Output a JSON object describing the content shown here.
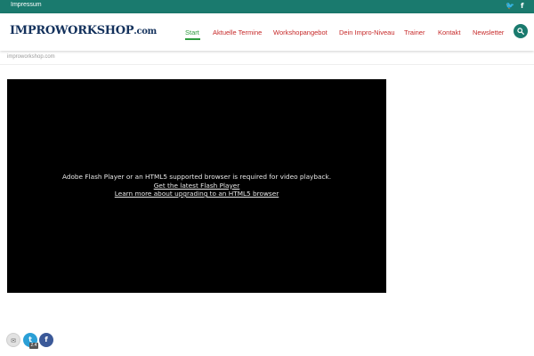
{
  "topbar": {
    "impressum_label": "Impressum",
    "social": [
      "twitter-icon",
      "facebook-icon"
    ],
    "color": "#1a7a6e"
  },
  "header": {
    "logo_main": "IMPROWORKSHOP",
    "logo_domain": ".com",
    "nav": [
      {
        "label": "Start",
        "active": true
      },
      {
        "label": "Aktuelle Termine",
        "active": false
      },
      {
        "label": "Workshopangebot",
        "active": false
      },
      {
        "label": "Dein Impro-Niveau",
        "active": false
      },
      {
        "label": "Trainer",
        "active": false
      },
      {
        "label": "Kontakt",
        "active": false
      },
      {
        "label": "Newsletter",
        "active": false
      }
    ],
    "nav_color": "#c62828",
    "active_color": "#2e9b3e",
    "search_icon": "search-icon"
  },
  "breadcrumb": "improworkshop.com",
  "video": {
    "message": "Adobe Flash Player or an HTML5 supported browser is required for video playback.",
    "link1": "Get the latest Flash Player",
    "link2": "Learn more about upgrading to an HTML5 browser"
  },
  "share": {
    "buttons": [
      "mail-icon",
      "twitter-icon",
      "facebook-icon"
    ],
    "twitter_count": "2.4"
  }
}
